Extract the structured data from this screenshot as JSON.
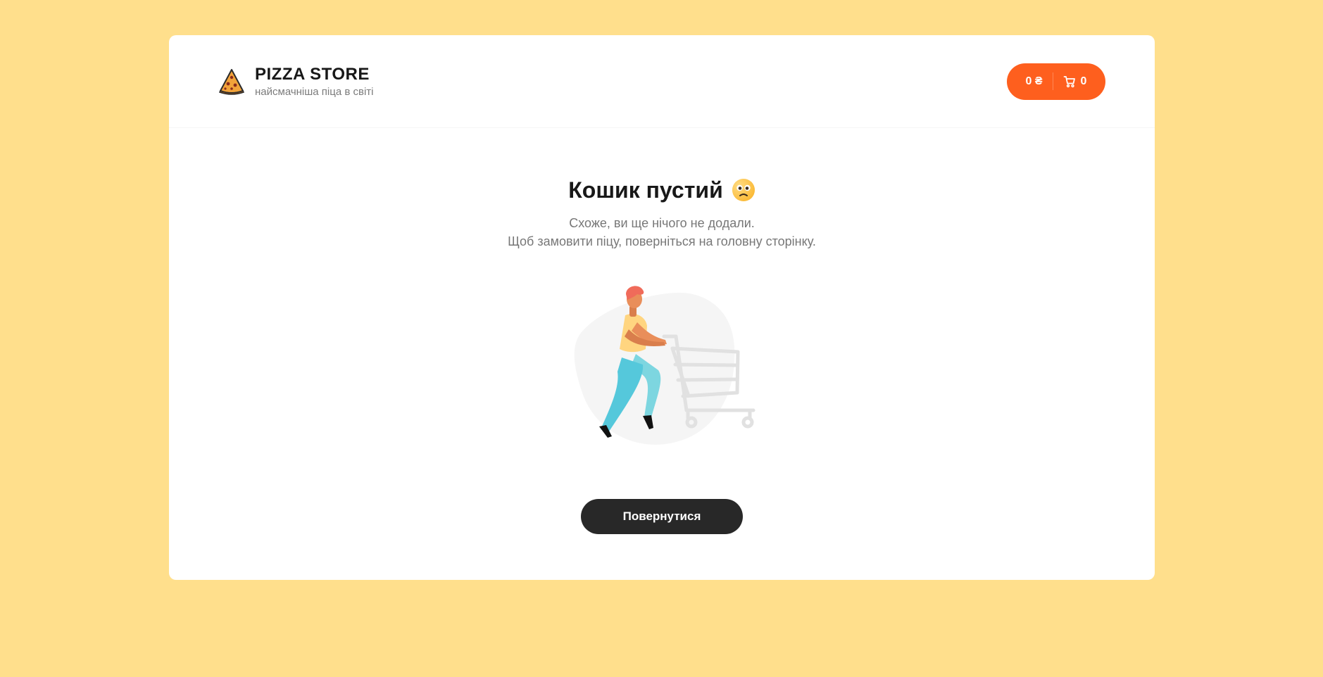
{
  "header": {
    "brand_name": "PIZZA STORE",
    "brand_tagline": "найсмачніша піца в світі",
    "logo_icon": "pizza-slice-icon"
  },
  "cart_button": {
    "price": "0 ₴",
    "count": "0",
    "icon": "shopping-cart-icon",
    "background": "#FE5F1E"
  },
  "empty_cart": {
    "title": "Кошик пустий",
    "emoji_icon": "confused-face-icon",
    "line1": "Схоже, ви ще нічого не додали.",
    "line2": "Щоб замовити піцу, поверніться на головну сторінку.",
    "illustration_icon": "person-pushing-empty-cart-illustration"
  },
  "back_button": {
    "label": "Повернутися",
    "background": "#282828"
  },
  "colors": {
    "page_background": "#FFDF8C",
    "card_background": "#FFFFFF",
    "accent": "#FE5F1E"
  }
}
